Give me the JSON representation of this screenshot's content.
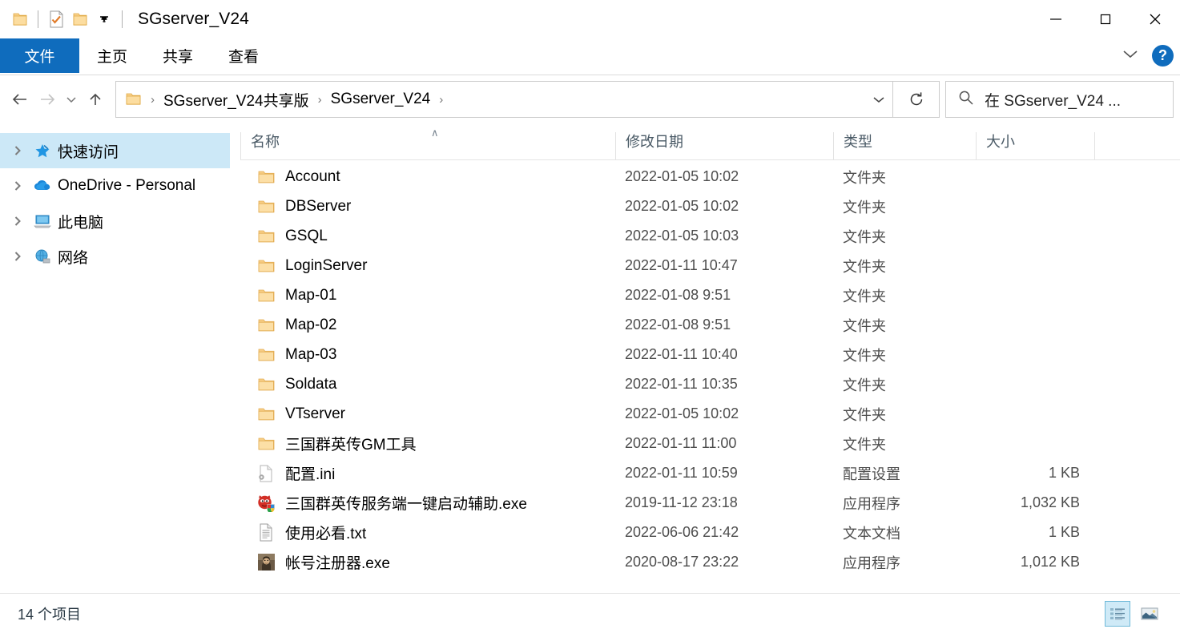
{
  "window": {
    "title": "SGserver_V24",
    "quick_access": [
      {
        "name": "folder-icon",
        "label": "文件夹"
      },
      {
        "name": "properties-icon",
        "label": "属性"
      },
      {
        "name": "new-folder-icon",
        "label": "新建文件夹"
      },
      {
        "name": "customize-qat-icon",
        "label": "自定义快速访问工具栏"
      }
    ],
    "controls": {
      "minimize": "─",
      "maximize": "☐",
      "close": "✕"
    }
  },
  "ribbon": {
    "tabs": [
      {
        "label": "文件",
        "active": true
      },
      {
        "label": "主页",
        "active": false
      },
      {
        "label": "共享",
        "active": false
      },
      {
        "label": "查看",
        "active": false
      }
    ],
    "collapse_icon": "chevron-down-icon",
    "help_label": "?"
  },
  "address": {
    "back_icon": "←",
    "forward_icon": "→",
    "recent_icon": "⌄",
    "up_icon": "↑",
    "breadcrumbs": [
      "SGserver_V24共享版",
      "SGserver_V24"
    ],
    "separator": "›",
    "dropdown_icon": "⌄",
    "refresh_icon": "↻"
  },
  "search": {
    "placeholder": "在 SGserver_V24 ...",
    "icon": "search-icon"
  },
  "sidebar": {
    "items": [
      {
        "label": "快速访问",
        "icon": "star-pin-icon",
        "selected": true,
        "expandable": true
      },
      {
        "label": "OneDrive - Personal",
        "icon": "onedrive-cloud-icon",
        "selected": false,
        "expandable": true
      },
      {
        "label": "此电脑",
        "icon": "this-pc-icon",
        "selected": false,
        "expandable": true
      },
      {
        "label": "网络",
        "icon": "network-globe-icon",
        "selected": false,
        "expandable": true
      }
    ]
  },
  "columns": {
    "name": "名称",
    "date": "修改日期",
    "type": "类型",
    "size": "大小",
    "sort_arrow": "∧"
  },
  "files": [
    {
      "name": "Account",
      "date": "2022-01-05 10:02",
      "type": "文件夹",
      "size": "",
      "icon": "folder-icon"
    },
    {
      "name": "DBServer",
      "date": "2022-01-05 10:02",
      "type": "文件夹",
      "size": "",
      "icon": "folder-icon"
    },
    {
      "name": "GSQL",
      "date": "2022-01-05 10:03",
      "type": "文件夹",
      "size": "",
      "icon": "folder-icon"
    },
    {
      "name": "LoginServer",
      "date": "2022-01-11 10:47",
      "type": "文件夹",
      "size": "",
      "icon": "folder-icon"
    },
    {
      "name": "Map-01",
      "date": "2022-01-08 9:51",
      "type": "文件夹",
      "size": "",
      "icon": "folder-icon"
    },
    {
      "name": "Map-02",
      "date": "2022-01-08 9:51",
      "type": "文件夹",
      "size": "",
      "icon": "folder-icon"
    },
    {
      "name": "Map-03",
      "date": "2022-01-11 10:40",
      "type": "文件夹",
      "size": "",
      "icon": "folder-icon"
    },
    {
      "name": "Soldata",
      "date": "2022-01-11 10:35",
      "type": "文件夹",
      "size": "",
      "icon": "folder-icon"
    },
    {
      "name": "VTserver",
      "date": "2022-01-05 10:02",
      "type": "文件夹",
      "size": "",
      "icon": "folder-icon"
    },
    {
      "name": "三国群英传GM工具",
      "date": "2022-01-11 11:00",
      "type": "文件夹",
      "size": "",
      "icon": "folder-icon"
    },
    {
      "name": "配置.ini",
      "date": "2022-01-11 10:59",
      "type": "配置设置",
      "size": "1 KB",
      "icon": "ini-config-icon"
    },
    {
      "name": "三国群英传服务端一键启动辅助.exe",
      "date": "2019-11-12 23:18",
      "type": "应用程序",
      "size": "1,032 KB",
      "icon": "devil-exe-icon"
    },
    {
      "name": "使用必看.txt",
      "date": "2022-06-06 21:42",
      "type": "文本文档",
      "size": "1 KB",
      "icon": "text-document-icon"
    },
    {
      "name": "帐号注册器.exe",
      "date": "2020-08-17 23:22",
      "type": "应用程序",
      "size": "1,012 KB",
      "icon": "warrior-exe-icon"
    }
  ],
  "status": {
    "item_count": "14 个项目",
    "views": [
      {
        "name": "details-view-button",
        "active": true
      },
      {
        "name": "large-icons-view-button",
        "active": false
      }
    ]
  },
  "colors": {
    "accent": "#0f6cbd",
    "selection": "#cce8f7",
    "folder": "#ffd075",
    "text": "#000000",
    "muted": "#4d4d4d"
  }
}
